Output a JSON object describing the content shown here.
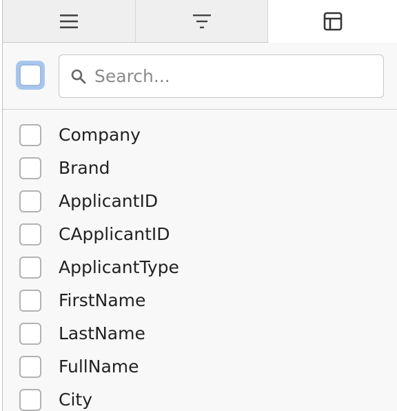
{
  "tabs": [
    {
      "name": "columns-tab",
      "icon": "menu-icon"
    },
    {
      "name": "filter-tab",
      "icon": "filter-icon"
    },
    {
      "name": "column-chooser-tab",
      "icon": "table-icon",
      "active": true
    }
  ],
  "search": {
    "placeholder": "Search...",
    "value": ""
  },
  "columns": [
    {
      "label": "Company",
      "checked": false
    },
    {
      "label": "Brand",
      "checked": false
    },
    {
      "label": "ApplicantID",
      "checked": false
    },
    {
      "label": "CApplicantID",
      "checked": false
    },
    {
      "label": "ApplicantType",
      "checked": false
    },
    {
      "label": "FirstName",
      "checked": false
    },
    {
      "label": "LastName",
      "checked": false
    },
    {
      "label": "FullName",
      "checked": false
    },
    {
      "label": "City",
      "checked": false
    }
  ],
  "colors": {
    "focus": "#a7c6ee",
    "panel_bg": "#f8f8f8",
    "tab_bg": "#efefef"
  }
}
